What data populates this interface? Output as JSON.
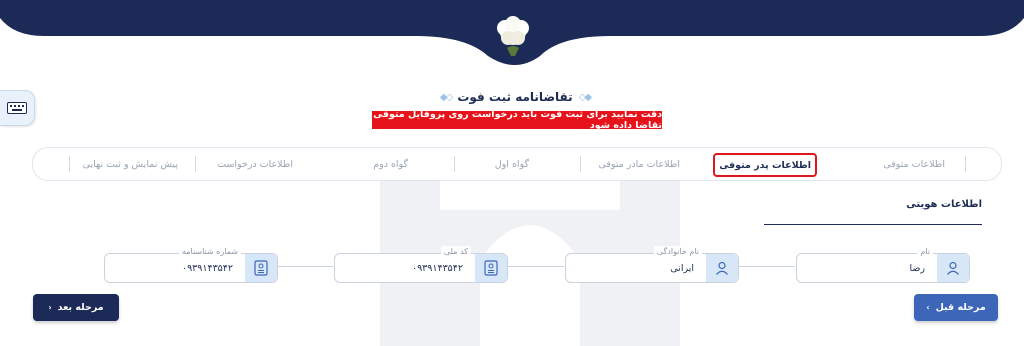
{
  "header": {
    "title": "تقاضانامه ثبت فوت",
    "warning": "دقت نمایید برای ثبت فوت باید درخواست روی پروفایل متوفی تقاضا داده شود"
  },
  "steps": [
    {
      "label": "اطلاعات متوفی",
      "active": false
    },
    {
      "label": "اطلاعات پدر متوفی",
      "active": true
    },
    {
      "label": "اطلاعات مادر متوفی",
      "active": false
    },
    {
      "label": "گواه اول",
      "active": false
    },
    {
      "label": "گواه دوم",
      "active": false
    },
    {
      "label": "اطلاعات درخواست",
      "active": false
    },
    {
      "label": "پیش نمایش و ثبت نهایی",
      "active": false
    }
  ],
  "section": {
    "title": "اطلاعات هویتی"
  },
  "fields": {
    "first_name": {
      "label": "نام",
      "value": "رضا",
      "icon": "user-icon"
    },
    "last_name": {
      "label": "نام خانوادگی",
      "value": "ایرانی",
      "icon": "user-icon"
    },
    "national_code": {
      "label": "کد ملی",
      "value": "۰۹۳۹۱۴۳۵۴۲",
      "icon": "id-card-icon"
    },
    "birth_cert": {
      "label": "شماره شناسنامه",
      "value": "۰۹۳۹۱۴۳۵۴۲",
      "icon": "id-card-icon"
    }
  },
  "buttons": {
    "prev": "مرحله قبل",
    "next": "مرحله بعد"
  },
  "colors": {
    "navy": "#1b2a56",
    "accent_blue": "#3d66b8",
    "warning_red": "#e6131b"
  }
}
